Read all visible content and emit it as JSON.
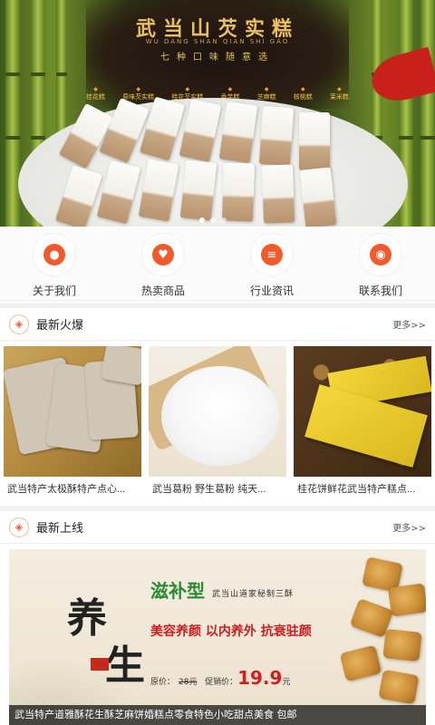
{
  "banner": {
    "title": "武当山芡实糕",
    "pinyin": "WU DANG SHAN QIAN SHI GAO",
    "subtitle": "七种口味随意选",
    "flavors": [
      "桂花糕",
      "原味芡实糕",
      "桂花芡实糕",
      "香芋糕",
      "芝麻糕",
      "核桃糕",
      "茉米糕"
    ]
  },
  "nav": [
    {
      "label": "关于我们",
      "icon": "person-icon"
    },
    {
      "label": "热卖商品",
      "icon": "heart-icon"
    },
    {
      "label": "行业资讯",
      "icon": "list-icon"
    },
    {
      "label": "联系我们",
      "icon": "cat-icon"
    }
  ],
  "hot": {
    "title": "最新火爆",
    "more": "更多>>",
    "products": [
      {
        "name": "武当特产太极酥特产点心..."
      },
      {
        "name": "武当葛粉 野生葛粉 纯天..."
      },
      {
        "name": "桂花饼鲜花武当特产糕点..."
      }
    ]
  },
  "new": {
    "title": "最新上线",
    "more": "更多>>"
  },
  "ad": {
    "big_title": "滋补型",
    "sub_title": "武当山道家秘制三酥",
    "slogan": "美容养颜 以内养外 抗衰驻颜",
    "price_label": "原价：",
    "old_price": "28元",
    "promo_label": "促销价：",
    "promo_price": "19.9",
    "promo_unit": "元",
    "brush_1": "养",
    "brush_2": "生",
    "caption": "武当特产道雅酥花生酥芝麻饼婚糕点零食特色小吃甜点美食 包邮"
  },
  "colors": {
    "accent": "#f25a2c",
    "price": "#d21e1e",
    "green_title": "#2a8a33"
  }
}
